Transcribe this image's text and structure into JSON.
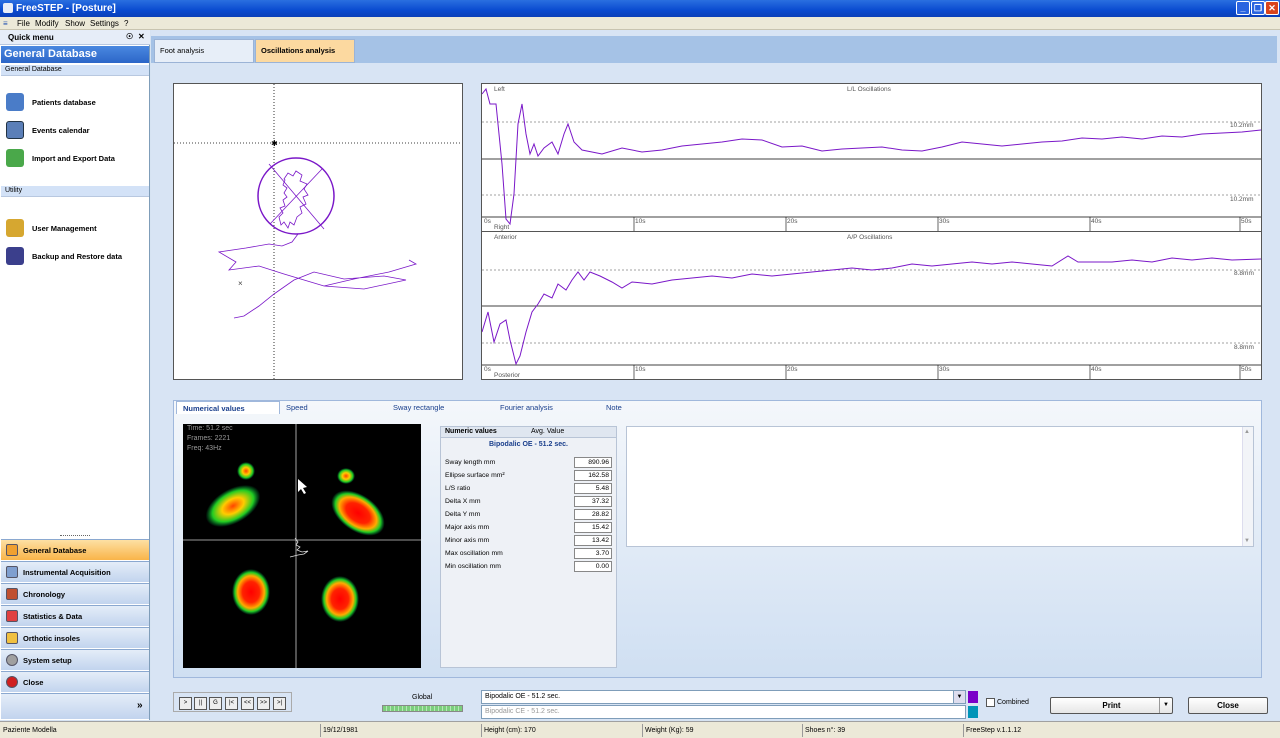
{
  "window": {
    "title": "FreeSTEP - [Posture]"
  },
  "menu": [
    "File",
    "Modify",
    "Show",
    "Settings",
    "?"
  ],
  "sidebar": {
    "quick_menu": "Quick menu",
    "pin_glyph": "☉",
    "close_glyph": "✕",
    "header": "General Database",
    "section1": "General Database",
    "items1": [
      "Patients database",
      "Events calendar",
      "Import and Export Data"
    ],
    "section2": "Utility",
    "items2": [
      "User Management",
      "Backup and Restore data"
    ],
    "nav": [
      "General Database",
      "Instrumental Acquisition",
      "Chronology",
      "Statistics & Data",
      "Orthotic insoles",
      "System setup",
      "Close"
    ],
    "active_nav": "General Database",
    "more_glyph": "»"
  },
  "top_tabs": [
    "Foot analysis",
    "Oscillations analysis"
  ],
  "active_top_tab": "Oscillations analysis",
  "charts": {
    "ll": {
      "title": "L/L Oscillations",
      "top_label": "Left",
      "bottom_label": "Right",
      "upper_limit": "10.2mm",
      "lower_limit": "10.2mm"
    },
    "ap": {
      "title": "A/P Oscillations",
      "top_label": "Anterior",
      "bottom_label": "Posterior",
      "upper_limit": "8.8mm",
      "lower_limit": "8.8mm"
    },
    "time_ticks": [
      "0s",
      "10s",
      "20s",
      "30s",
      "40s",
      "50s"
    ]
  },
  "bottom_tabs": [
    "Numerical values",
    "Speed",
    "Sway rectangle",
    "Fourier analysis",
    "Note"
  ],
  "active_bottom_tab": "Numerical values",
  "pressure": {
    "time": "Time: 51.2 sec",
    "frames": "Frames: 2221",
    "freq": "Freq: 43Hz"
  },
  "numeric": {
    "col1": "Numeric values",
    "col2": "Avg. Value",
    "title": "Bipodalic OE - 51.2 sec.",
    "rows": [
      {
        "k": "Sway length mm",
        "v": "890.96"
      },
      {
        "k": "Ellipse surface mm²",
        "v": "162.58"
      },
      {
        "k": "L/S ratio",
        "v": "5.48"
      },
      {
        "k": "Delta X mm",
        "v": "37.32"
      },
      {
        "k": "Delta Y mm",
        "v": "28.82"
      },
      {
        "k": "Major axis mm",
        "v": "15.42"
      },
      {
        "k": "Minor axis mm",
        "v": "13.42"
      },
      {
        "k": "Max oscillation mm",
        "v": "3.70"
      },
      {
        "k": "Min oscillation mm",
        "v": "0.00"
      }
    ]
  },
  "playback": {
    "buttons": [
      ">",
      "||",
      "G",
      "|<",
      "<<",
      ">>",
      ">|"
    ],
    "global_label": "Global"
  },
  "combos": {
    "first": "Bipodalic OE - 51.2 sec.",
    "second": "Bipodalic CE - 51.2 sec."
  },
  "combined_label": "Combined",
  "print_label": "Print",
  "close_label": "Close",
  "colors": {
    "trace": "#7a17c8",
    "combo1": "#7a00c8",
    "combo2": "#0094b8"
  },
  "statusbar": [
    "Paziente Modella",
    "19/12/1981",
    "Height (cm): 170",
    "Weight (Kg): 59",
    "Shoes n°: 39",
    "FreeStep v.1.1.12"
  ]
}
